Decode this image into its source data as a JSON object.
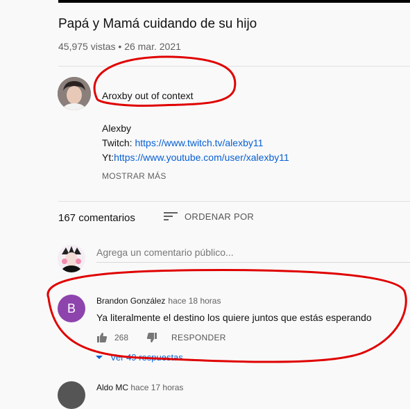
{
  "video": {
    "title": "Papá y Mamá cuidando de su hijo",
    "views": "45,975 vistas",
    "date": "26 mar. 2021"
  },
  "channel": {
    "name": "Aroxby out of context"
  },
  "description": {
    "line1": "Alexby",
    "twitch_label": "Twitch: ",
    "twitch_url": "https://www.twitch.tv/alexby11",
    "yt_label": "Yt:",
    "yt_url": "https://www.youtube.com/user/xalexby11",
    "show_more": "MOSTRAR MÁS"
  },
  "comments": {
    "count_label": "167 comentarios",
    "sort_label": "ORDENAR POR",
    "add_placeholder": "Agrega un comentario público...",
    "list": [
      {
        "avatar_letter": "B",
        "author": "Brandon González",
        "time": "hace 18 horas",
        "text": "Ya literalmente el destino los quiere juntos que estás esperando",
        "likes": "268",
        "reply_label": "RESPONDER",
        "replies_label": "Ver 49 respuestas"
      },
      {
        "author": "Aldo MC",
        "time": "hace 17 horas"
      }
    ]
  },
  "colors": {
    "link": "#065fd4",
    "annotation": "#e00000",
    "avatar_b": "#8e44ad"
  },
  "icons": [
    "sort-icon",
    "like-icon",
    "dislike-icon",
    "expand-icon"
  ]
}
